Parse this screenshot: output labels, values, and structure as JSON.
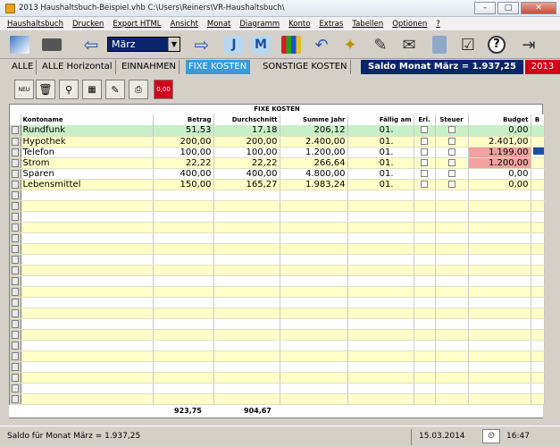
{
  "window": {
    "title": "2013 Haushaltsbuch-Beispiel.vhb   C:\\Users\\Reiners\\VR-Haushaltsbuch\\"
  },
  "menu": [
    "Haushaltsbuch",
    "Drucken",
    "Export HTML",
    "Ansicht",
    "Monat",
    "Diagramm",
    "Konto",
    "Extras",
    "Tabellen",
    "Optionen",
    "?"
  ],
  "toolbar": {
    "month": "März"
  },
  "tabs": [
    "ALLE",
    "ALLE Horizontal",
    "EINNAHMEN",
    "FIXE KOSTEN",
    "SONSTIGE KOSTEN"
  ],
  "active_tab": "FIXE KOSTEN",
  "saldo_header": "Saldo Monat März = 1.937,25",
  "year": "2013",
  "toolbar2": {
    "new_label": "NEU",
    "red_label": "0,00"
  },
  "grid": {
    "caption": "FIXE KOSTEN",
    "columns": [
      "Kontoname",
      "Betrag",
      "Durchschnitt",
      "Summe Jahr",
      "Fällig am",
      "Erl.",
      "Steuer",
      "Budget",
      "B"
    ],
    "rows": [
      {
        "name": "Rundfunk",
        "betrag": "51,53",
        "durchschnitt": "17,18",
        "summe": "206,12",
        "faellig": "01.",
        "budget": "0,00",
        "style": "green",
        "over": false
      },
      {
        "name": "Hypothek",
        "betrag": "200,00",
        "durchschnitt": "200,00",
        "summe": "2.400,00",
        "faellig": "01.",
        "budget": "2.401,00",
        "style": "yellow",
        "over": false
      },
      {
        "name": "Telefon",
        "betrag": "100,00",
        "durchschnitt": "100,00",
        "summe": "1.200,00",
        "faellig": "01.",
        "budget": "1.199,00",
        "style": "white",
        "over": true
      },
      {
        "name": "Strom",
        "betrag": "22,22",
        "durchschnitt": "22,22",
        "summe": "266,64",
        "faellig": "01.",
        "budget": "1.200,00",
        "style": "yellow",
        "over": true
      },
      {
        "name": "Sparen",
        "betrag": "400,00",
        "durchschnitt": "400,00",
        "summe": "4.800,00",
        "faellig": "01.",
        "budget": "0,00",
        "style": "white",
        "over": false
      },
      {
        "name": "Lebensmittel",
        "betrag": "150,00",
        "durchschnitt": "165,27",
        "summe": "1.983,24",
        "faellig": "01.",
        "budget": "0,00",
        "style": "yellow",
        "over": false
      }
    ],
    "totals": {
      "betrag": "923,75",
      "durchschnitt": "904,67"
    }
  },
  "status": {
    "saldo": "Saldo für Monat März = 1.937,25",
    "date": "15.03.2014",
    "time": "16:47"
  },
  "colors": {
    "selection": "#0a246a",
    "active_tab": "#3a9bd9",
    "year_box": "#d0021b",
    "over_budget": "#f4a0a0"
  }
}
